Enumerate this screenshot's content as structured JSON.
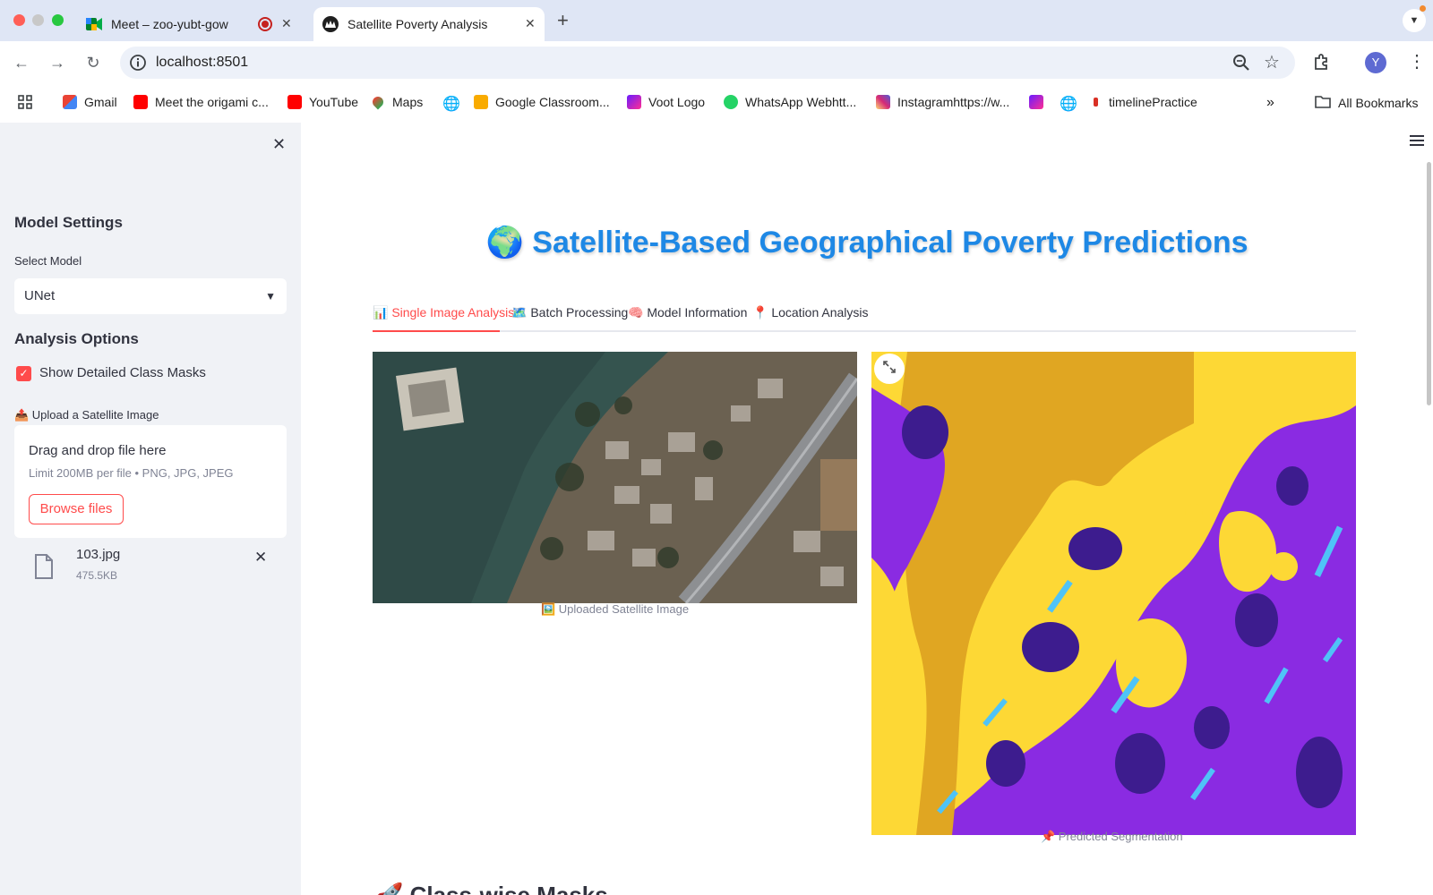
{
  "browser": {
    "tabs": [
      {
        "title": "Meet – zoo-yubt-gow",
        "active": false
      },
      {
        "title": "Satellite Poverty Analysis",
        "active": true
      }
    ],
    "url": "localhost:8501",
    "profile_initial": "Y",
    "bookmarks": [
      {
        "label": "Gmail",
        "icon": "gmail-icon",
        "color": "#ea4335"
      },
      {
        "label": "Meet the origami c...",
        "icon": "youtube-icon",
        "color": "#ff0000"
      },
      {
        "label": "YouTube",
        "icon": "youtube-icon",
        "color": "#ff0000"
      },
      {
        "label": "Maps",
        "icon": "maps-icon",
        "color": "#34a853"
      },
      {
        "label": "Google Classroom...",
        "icon": "classroom-icon",
        "color": "#f9ab00"
      },
      {
        "label": "Voot Logo",
        "icon": "voot-icon",
        "color": "#6a1bff"
      },
      {
        "label": "WhatsApp Webhtt...",
        "icon": "whatsapp-icon",
        "color": "#25d366"
      },
      {
        "label": "Instagramhttps://w...",
        "icon": "instagram-icon",
        "color": "#e1306c"
      },
      {
        "label": "timelinePractice",
        "icon": "dot-icon",
        "color": "#d93025"
      }
    ],
    "all_bookmarks": "All Bookmarks"
  },
  "sidebar": {
    "model_settings": "Model Settings",
    "select_model_label": "Select Model",
    "select_model_value": "UNet",
    "analysis_options": "Analysis Options",
    "show_masks_label": "Show Detailed Class Masks",
    "show_masks_checked": true,
    "upload_label": "📤 Upload a Satellite Image",
    "dropzone_title": "Drag and drop file here",
    "dropzone_limit": "Limit 200MB per file • PNG, JPG, JPEG",
    "browse_button": "Browse files",
    "file_name": "103.jpg",
    "file_size": "475.5KB"
  },
  "main": {
    "title_icon": "🌍",
    "title": "Satellite-Based Geographical Poverty Predictions",
    "tabs": [
      {
        "label": "📊 Single Image Analysis",
        "active": true
      },
      {
        "label": "🗺️ Batch Processing",
        "active": false
      },
      {
        "label": "🧠 Model Information",
        "active": false
      },
      {
        "label": "📍 Location Analysis",
        "active": false
      }
    ],
    "uploaded_caption": "🖼️ Uploaded Satellite Image",
    "prediction_caption": "📌 Predicted Segmentation",
    "next_section": "🚀 Class-wise Masks",
    "colors": {
      "accent": "#ff4b4b",
      "title_blue": "#1e88e5",
      "seg_purple": "#8a2be2",
      "seg_yellow": "#fdd835",
      "seg_orange": "#e0a622",
      "seg_dark": "#3d1c8e",
      "seg_cyan": "#4fc3f7"
    }
  }
}
